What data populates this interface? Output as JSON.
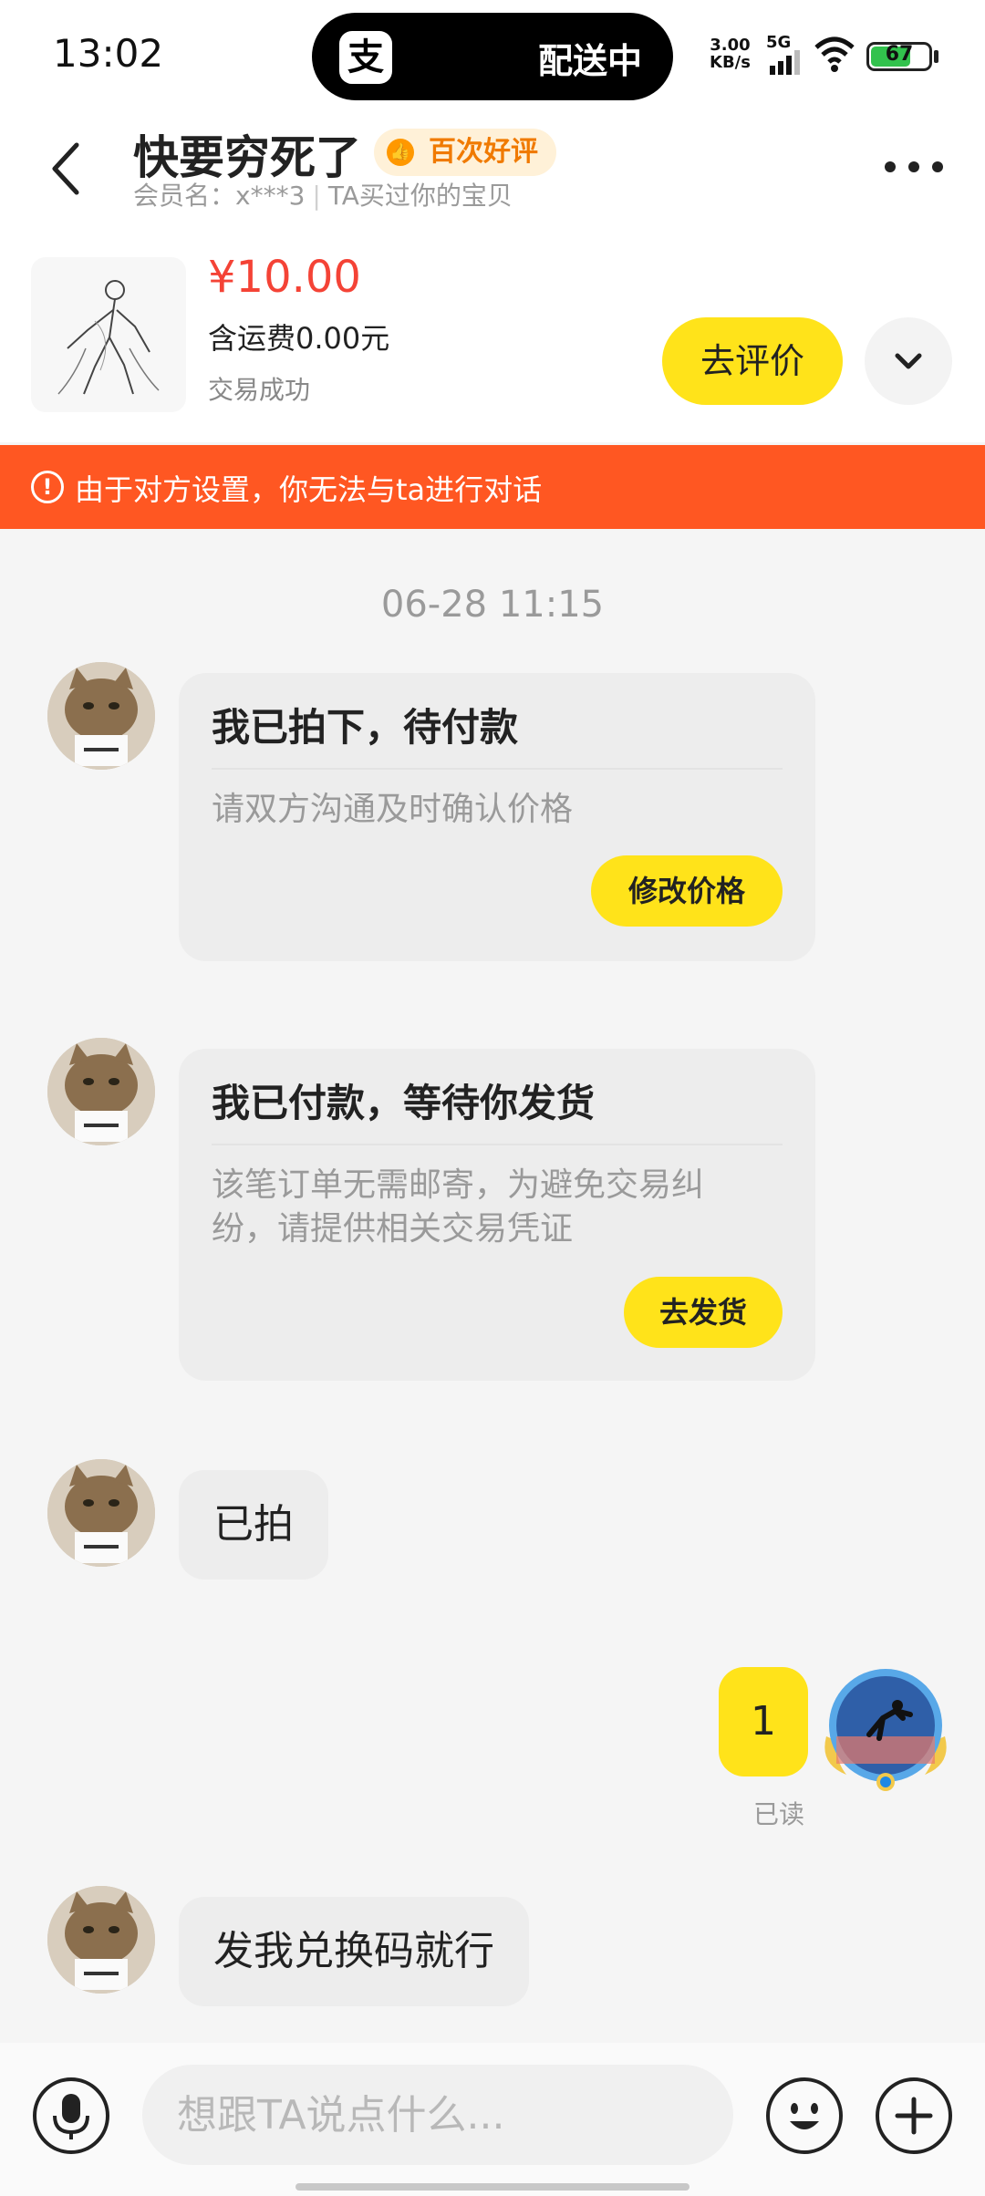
{
  "status_bar": {
    "time": "13:02",
    "island_text": "配送中",
    "net_speed_value": "3.00",
    "net_speed_unit": "KB/s",
    "network": "5G",
    "battery": "67"
  },
  "header": {
    "title": "快要穷死了",
    "badge": "百次好评",
    "member_label": "会员名：x***3",
    "member_note": "TA买过你的宝贝"
  },
  "product": {
    "price": "¥10.00",
    "shipping": "含运费0.00元",
    "status": "交易成功",
    "review_button": "去评价"
  },
  "warning": {
    "text": "由于对方设置，你无法与ta进行对话"
  },
  "chat": {
    "timestamp": "06-28 11:15",
    "card1": {
      "title": "我已拍下，待付款",
      "body": "请双方沟通及时确认价格",
      "button": "修改价格"
    },
    "card2": {
      "title": "我已付款，等待你发货",
      "body_line1": "该笔订单无需邮寄，为避免交易纠",
      "body_line2": "纷，请提供相关交易凭证",
      "button": "去发货"
    },
    "msg1": "已拍",
    "my_msg": "1",
    "read_status": "已读",
    "msg2": "发我兑换码就行"
  },
  "input": {
    "placeholder": "想跟TA说点什么..."
  },
  "colors": {
    "accent_yellow": "#ffe31a",
    "warning_orange": "#ff5722",
    "price_red": "#f44336"
  },
  "icons": [
    "back-icon",
    "more-icon",
    "chevron-down-icon",
    "warning-icon",
    "microphone-icon",
    "emoji-icon",
    "plus-icon"
  ]
}
